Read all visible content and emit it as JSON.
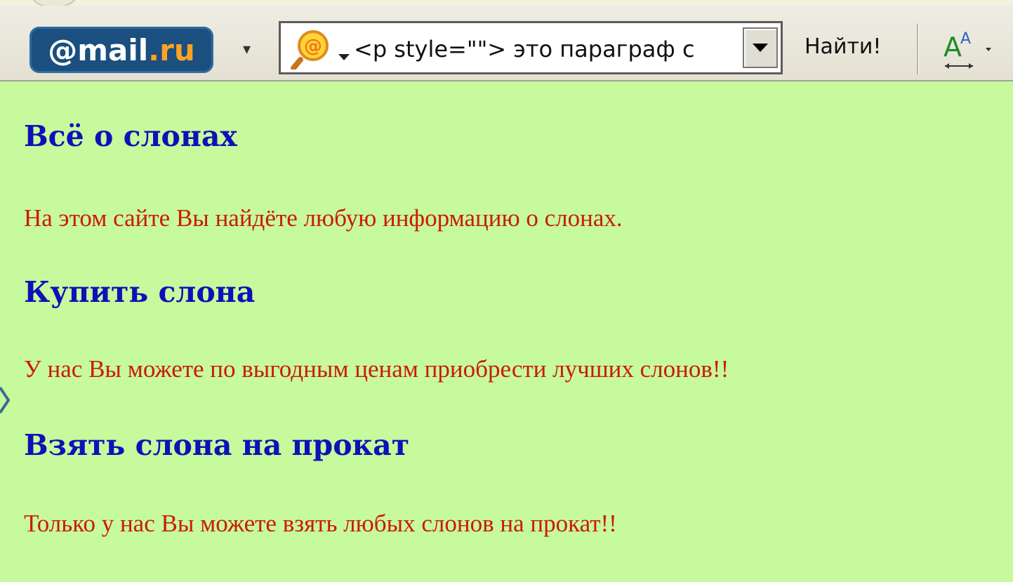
{
  "toolbar": {
    "logo": {
      "prefix": "@",
      "brand": "mail",
      "suffix": ".ru"
    },
    "logo_dropdown_symbol": "▾",
    "search": {
      "value": "<p style=\"\"> это параграф с"
    },
    "find_button_label": "Найти!",
    "font_size_button": "A-A"
  },
  "page": {
    "heading1": "Всё о слонах",
    "para1": "На этом сайте Вы найдёте любую информацию о слонах.",
    "heading2": "Купить слона",
    "para2": "У нас Вы можете по выгодным ценам приобрести лучших слонов!!",
    "heading3": "Взять слона на прокат",
    "para3": "Только у нас Вы можете взять любых слонов на прокат!!"
  },
  "colors": {
    "page_background": "#c6fa9c",
    "heading": "#1010b8",
    "paragraph": "#cc1b00",
    "logo_background": "#1a4f7f",
    "logo_accent": "#ffa224"
  }
}
